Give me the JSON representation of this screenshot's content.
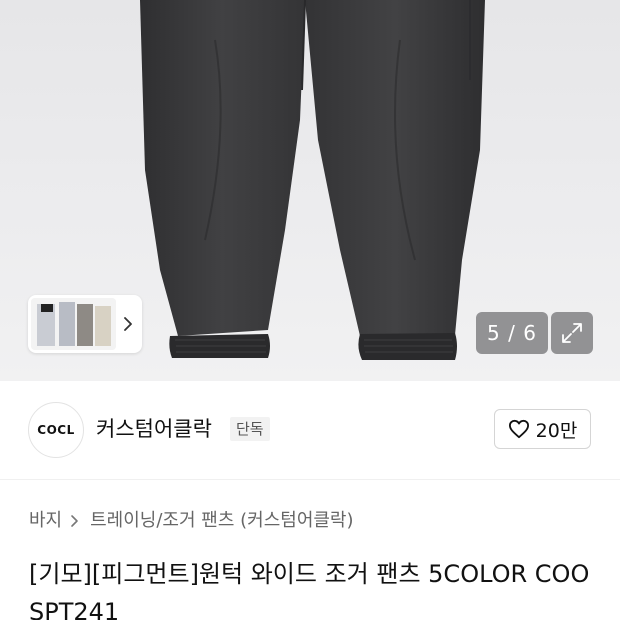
{
  "gallery": {
    "counter": "5 / 6",
    "icons": {
      "thumbnail_next": "chevron-right-icon",
      "expand": "expand-icon"
    }
  },
  "brand": {
    "logo_text": "COCL",
    "name": "커스텀어클락",
    "badge": "단독",
    "likes": "20만",
    "like_icon": "heart-icon"
  },
  "breadcrumb": {
    "category": "바지",
    "subcategory": "트레이닝/조거 팬츠 (커스텀어클락)"
  },
  "product": {
    "title": "[기모][피그먼트]원턱 와이드 조거 팬츠 5COLOR COOSPT241"
  },
  "colors": {
    "pants": "#3c3c3e",
    "pants_shadow": "#2c2c2e",
    "hero_bg": "#ececee"
  }
}
